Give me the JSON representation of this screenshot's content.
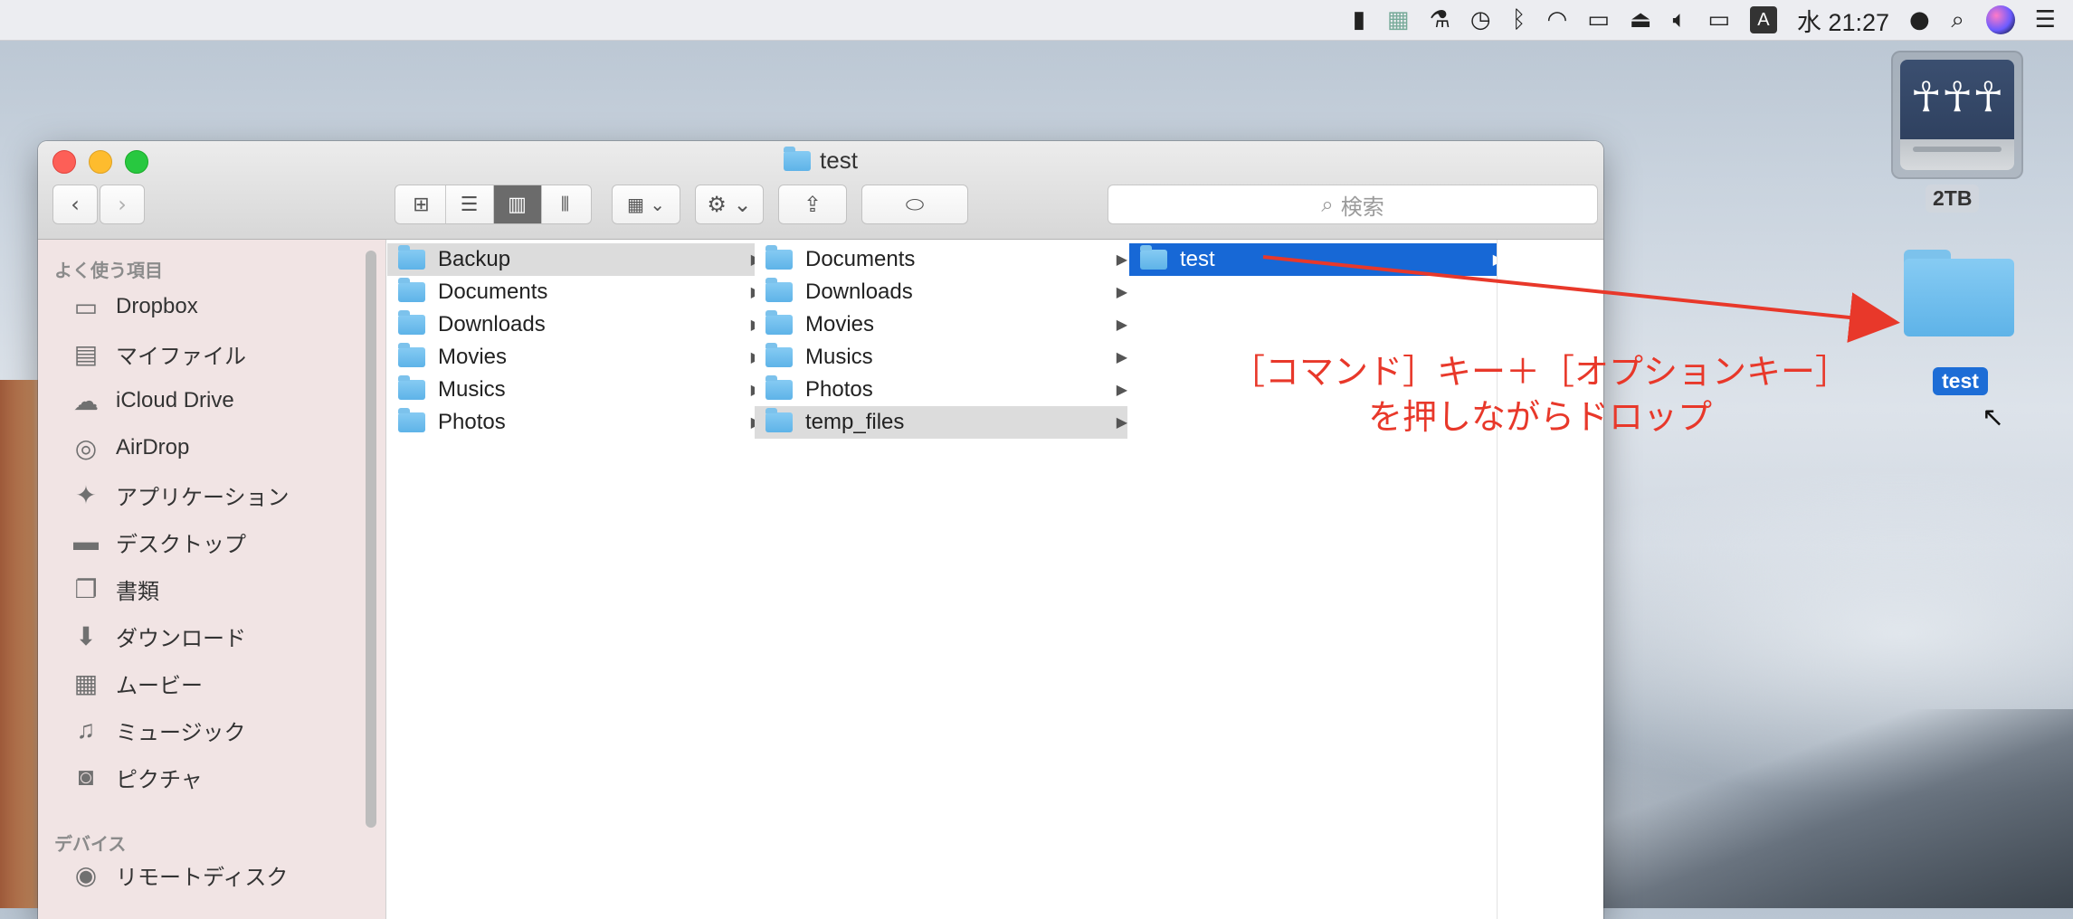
{
  "menubar": {
    "clock": "水 21:27",
    "input_source": "A",
    "icons": [
      "menu-extra-1-icon",
      "menu-extra-2-icon",
      "cleaner-icon",
      "time-machine-icon",
      "bluetooth-icon",
      "wifi-icon",
      "airplay-icon",
      "eject-icon",
      "volume-icon",
      "battery-icon",
      "input-source-icon",
      "user-icon",
      "spotlight-icon",
      "siri-icon",
      "notification-center-icon"
    ]
  },
  "desktop": {
    "drive_label": "2TB",
    "folder_label": "test"
  },
  "window": {
    "title": "test",
    "search_placeholder": "検索"
  },
  "sidebar": {
    "favorites_header": "よく使う項目",
    "items": [
      {
        "label": "Dropbox",
        "icon": "folder-icon"
      },
      {
        "label": "マイファイル",
        "icon": "all-files-icon"
      },
      {
        "label": "iCloud Drive",
        "icon": "cloud-icon"
      },
      {
        "label": "AirDrop",
        "icon": "airdrop-icon"
      },
      {
        "label": "アプリケーション",
        "icon": "applications-icon"
      },
      {
        "label": "デスクトップ",
        "icon": "desktop-icon"
      },
      {
        "label": "書類",
        "icon": "documents-icon"
      },
      {
        "label": "ダウンロード",
        "icon": "downloads-icon"
      },
      {
        "label": "ムービー",
        "icon": "movies-icon"
      },
      {
        "label": "ミュージック",
        "icon": "music-icon"
      },
      {
        "label": "ピクチャ",
        "icon": "pictures-icon"
      }
    ],
    "devices_header": "デバイス",
    "devices": [
      {
        "label": "リモートディスク",
        "icon": "remote-disc-icon"
      }
    ]
  },
  "columns": [
    {
      "items": [
        "Backup",
        "Documents",
        "Downloads",
        "Movies",
        "Musics",
        "Photos"
      ],
      "selected": 0,
      "selection_style": "inactive"
    },
    {
      "items": [
        "Documents",
        "Downloads",
        "Movies",
        "Musics",
        "Photos",
        "temp_files"
      ],
      "selected": 5,
      "selection_style": "inactive"
    },
    {
      "items": [
        "test"
      ],
      "selected": 0,
      "selection_style": "active"
    }
  ],
  "annotation": {
    "line1": "［コマンド］キー＋［オプションキー］",
    "line2": "を押しながらドロップ",
    "color": "#e8382a"
  },
  "colors": {
    "selection_blue": "#1768d6",
    "folder_blue": "#5eb3e8"
  }
}
